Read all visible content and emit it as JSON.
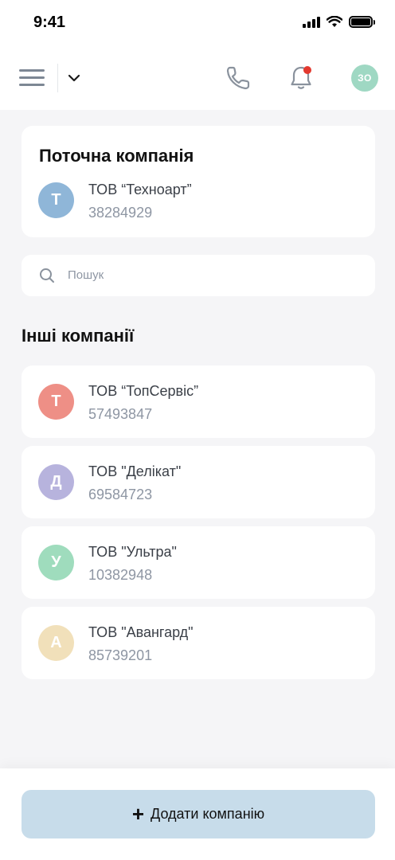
{
  "status_bar": {
    "time": "9:41"
  },
  "header": {
    "menu_icon": "hamburger-icon",
    "dropdown_icon": "chevron-down-icon",
    "phone_icon": "phone-icon",
    "notifications_icon": "bell-icon",
    "user_initials": "ЗО",
    "colors": {
      "avatar": "#9fd8c3",
      "notification_dot": "#e3392f",
      "icon": "#7d8794"
    }
  },
  "current_company": {
    "section_title": "Поточна компанія",
    "initial": "Т",
    "name": "ТОВ “Техноарт”",
    "code": "38284929",
    "color": "#8fb6d8"
  },
  "search": {
    "placeholder": "Пошук"
  },
  "other_companies": {
    "section_title": "Інші компанії",
    "items": [
      {
        "initial": "Т",
        "name": "ТОВ “ТопСервіс”",
        "code": "57493847",
        "color": "#ee8f86"
      },
      {
        "initial": "Д",
        "name": "ТОВ \"Делікат\"",
        "code": "69584723",
        "color": "#b7b3dd"
      },
      {
        "initial": "У",
        "name": "ТОВ \"Ультра\"",
        "code": "10382948",
        "color": "#9fdcbd"
      },
      {
        "initial": "А",
        "name": "ТОВ \"Авангард\"",
        "code": "85739201",
        "color": "#f1e0ba"
      }
    ]
  },
  "footer": {
    "add_button_icon": "plus-icon",
    "add_button_label": "Додати компанію",
    "add_button_color": "#c7dcea"
  }
}
